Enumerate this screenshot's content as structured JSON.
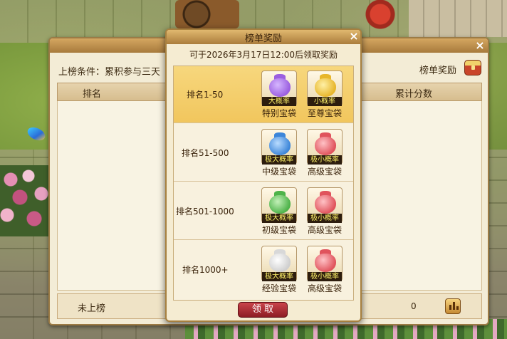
{
  "colors": {
    "panel_bg": "#f3ecd6",
    "title_gold": "#e0b86f",
    "highlight_row": "#f7d77d",
    "claim_button": "#b03038",
    "tag_text": "#fff36a"
  },
  "back_panel": {
    "close_icon": "×",
    "condition_label": "上榜条件：累积参与三天",
    "reward_link_label": "榜单奖励",
    "chest_icon": "treasure-chest-icon",
    "columns": {
      "rank": "排名",
      "score": "累计分数"
    },
    "my_row": {
      "rank": "未上榜",
      "score": "0"
    },
    "chart_icon": "bar-chart-icon"
  },
  "popup": {
    "title": "榜单奖励",
    "close_icon": "×",
    "subtitle": "可于2026年3月17日12:00后领取奖励",
    "claim_label": "领 取",
    "tiers": [
      {
        "rank": "排名1-50",
        "selected": true,
        "rewards": [
          {
            "tag": "大概率",
            "name": "特别宝袋",
            "color": "#9b5fe0"
          },
          {
            "tag": "小概率",
            "name": "至尊宝袋",
            "color": "#e7b62b"
          }
        ]
      },
      {
        "rank": "排名51-500",
        "selected": false,
        "rewards": [
          {
            "tag": "极大概率",
            "name": "中级宝袋",
            "color": "#3d86d9"
          },
          {
            "tag": "极小概率",
            "name": "高级宝袋",
            "color": "#e0535c"
          }
        ]
      },
      {
        "rank": "排名501-1000",
        "selected": false,
        "rewards": [
          {
            "tag": "极大概率",
            "name": "初级宝袋",
            "color": "#4eb34a"
          },
          {
            "tag": "极小概率",
            "name": "高级宝袋",
            "color": "#e0535c"
          }
        ]
      },
      {
        "rank": "排名1000+",
        "selected": false,
        "rewards": [
          {
            "tag": "极大概率",
            "name": "经验宝袋",
            "color": "#e9e9e9"
          },
          {
            "tag": "极小概率",
            "name": "高级宝袋",
            "color": "#e0535c"
          }
        ]
      }
    ]
  }
}
